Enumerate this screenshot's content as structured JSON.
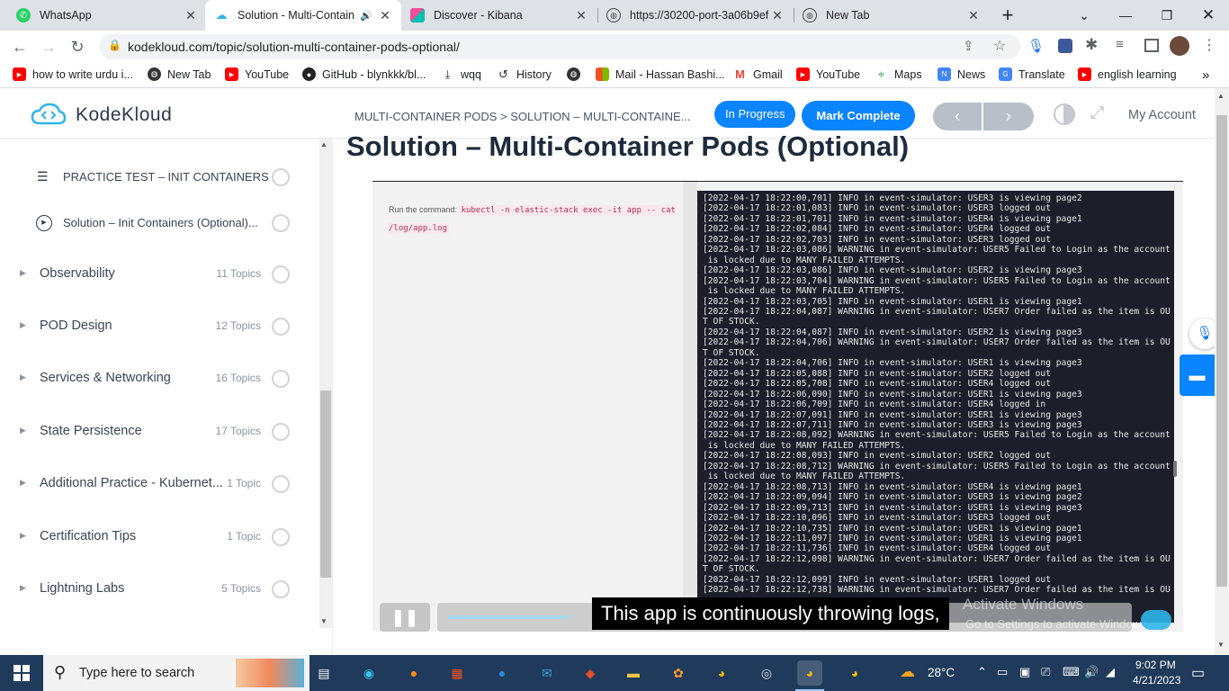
{
  "browser": {
    "tabs": [
      {
        "title": "WhatsApp",
        "icon": "whatsapp-icon"
      },
      {
        "title": "Solution - Multi-Contain",
        "icon": "kodekloud-icon",
        "active": true
      },
      {
        "title": "Discover - Kibana",
        "icon": "kibana-icon"
      },
      {
        "title": "https://30200-port-3a06b9ef",
        "icon": "globe-icon"
      },
      {
        "title": "New Tab",
        "icon": "globe-icon"
      }
    ],
    "url": "kodekloud.com/topic/solution-multi-container-pods-optional/",
    "bookmarks": [
      {
        "label": "how to write urdu i...",
        "icon": "youtube-icon"
      },
      {
        "label": "New Tab",
        "icon": "globe-icon"
      },
      {
        "label": "YouTube",
        "icon": "youtube-icon"
      },
      {
        "label": "GitHub - blynkkk/bl...",
        "icon": "github-icon"
      },
      {
        "label": "wqq",
        "icon": "download-icon"
      },
      {
        "label": "History",
        "icon": "history-icon"
      },
      {
        "label": "",
        "icon": "globe-icon"
      },
      {
        "label": "Mail - Hassan Bashi...",
        "icon": "microsoft-icon"
      },
      {
        "label": "Gmail",
        "icon": "gmail-icon"
      },
      {
        "label": "YouTube",
        "icon": "youtube-icon"
      },
      {
        "label": "Maps",
        "icon": "maps-icon"
      },
      {
        "label": "News",
        "icon": "news-icon"
      },
      {
        "label": "Translate",
        "icon": "translate-icon"
      },
      {
        "label": "english learning",
        "icon": "youtube-icon"
      }
    ]
  },
  "kk": {
    "brand": "KodeKloud",
    "breadcrumb": "MULTI-CONTAINER PODS > SOLUTION – MULTI-CONTAINE...",
    "status_label": "In Progress",
    "complete_label": "Mark Complete",
    "account_label": "My Account",
    "title": "Solution – Multi-Container Pods (Optional)",
    "sidebar": {
      "lessons": [
        {
          "label": "PRACTICE TEST – INIT CONTAINERS",
          "icon": "list-icon"
        },
        {
          "label": "Solution – Init Containers (Optional)...",
          "icon": "play-icon"
        }
      ],
      "sections": [
        {
          "label": "Observability",
          "count": "11 Topics"
        },
        {
          "label": "POD Design",
          "count": "12 Topics"
        },
        {
          "label": "Services & Networking",
          "count": "16 Topics"
        },
        {
          "label": "State Persistence",
          "count": "17 Topics"
        },
        {
          "label": "Additional Practice - Kubernet...",
          "count": "1 Topic"
        },
        {
          "label": "Certification Tips",
          "count": "1 Topic"
        },
        {
          "label": "Lightning Labs",
          "count": "5 Topics"
        }
      ]
    },
    "video": {
      "instruction_prefix": "Run the command:",
      "command": "kubectl -n elastic-stack exec -it app -- cat /log/app.log",
      "caption": "This app is continuously throwing logs,",
      "watermark_line1": "Activate Windows",
      "watermark_line2": "Go to Settings to activate Windows.",
      "progress": 0.18,
      "terminal_lines": [
        "[2022-04-17 18:22:00,701] INFO in event-simulator: USER3 is viewing page2",
        "[2022-04-17 18:22:01,083] INFO in event-simulator: USER3 logged out",
        "[2022-04-17 18:22:01,701] INFO in event-simulator: USER4 is viewing page1",
        "[2022-04-17 18:22:02,084] INFO in event-simulator: USER4 logged out",
        "[2022-04-17 18:22:02,703] INFO in event-simulator: USER3 logged out",
        "[2022-04-17 18:22:03,086] WARNING in event-simulator: USER5 Failed to Login as the account",
        " is locked due to MANY FAILED ATTEMPTS.",
        "[2022-04-17 18:22:03,086] INFO in event-simulator: USER2 is viewing page3",
        "[2022-04-17 18:22:03,704] WARNING in event-simulator: USER5 Failed to Login as the account",
        " is locked due to MANY FAILED ATTEMPTS.",
        "[2022-04-17 18:22:03,705] INFO in event-simulator: USER1 is viewing page1",
        "[2022-04-17 18:22:04,087] WARNING in event-simulator: USER7 Order failed as the item is OU",
        "T OF STOCK.",
        "[2022-04-17 18:22:04,087] INFO in event-simulator: USER2 is viewing page3",
        "[2022-04-17 18:22:04,706] WARNING in event-simulator: USER7 Order failed as the item is OU",
        "T OF STOCK.",
        "[2022-04-17 18:22:04,706] INFO in event-simulator: USER1 is viewing page3",
        "[2022-04-17 18:22:05,088] INFO in event-simulator: USER2 logged out",
        "[2022-04-17 18:22:05,708] INFO in event-simulator: USER4 logged out",
        "[2022-04-17 18:22:06,090] INFO in event-simulator: USER1 is viewing page3",
        "[2022-04-17 18:22:06,709] INFO in event-simulator: USER4 logged in",
        "[2022-04-17 18:22:07,091] INFO in event-simulator: USER1 is viewing page3",
        "[2022-04-17 18:22:07,711] INFO in event-simulator: USER3 is viewing page3",
        "[2022-04-17 18:22:08,092] WARNING in event-simulator: USER5 Failed to Login as the account",
        " is locked due to MANY FAILED ATTEMPTS.",
        "[2022-04-17 18:22:08,093] INFO in event-simulator: USER2 logged out",
        "[2022-04-17 18:22:08,712] WARNING in event-simulator: USER5 Failed to Login as the account",
        " is locked due to MANY FAILED ATTEMPTS.",
        "[2022-04-17 18:22:08,713] INFO in event-simulator: USER4 is viewing page1",
        "[2022-04-17 18:22:09,094] INFO in event-simulator: USER3 is viewing page2",
        "[2022-04-17 18:22:09,713] INFO in event-simulator: USER1 is viewing page3",
        "[2022-04-17 18:22:10,096] INFO in event-simulator: USER3 logged out",
        "[2022-04-17 18:22:10,735] INFO in event-simulator: USER1 is viewing page1",
        "[2022-04-17 18:22:11,097] INFO in event-simulator: USER1 is viewing page1",
        "[2022-04-17 18:22:11,736] INFO in event-simulator: USER4 logged out",
        "[2022-04-17 18:22:12,098] WARNING in event-simulator: USER7 Order failed as the item is OU",
        "T OF STOCK.",
        "[2022-04-17 18:22:12,099] INFO in event-simulator: USER1 logged out",
        "[2022-04-17 18:22:12,738] WARNING in event-simulator: USER7 Order failed as the item is OU"
      ]
    }
  },
  "taskbar": {
    "search_placeholder": "Type here to search",
    "weather": "28°C",
    "time": "9:02 PM",
    "date": "4/21/2023"
  },
  "colors": {
    "accent": "#0a84ff",
    "dark_text": "#1e2b3c",
    "taskbar": "#1f3a5a"
  }
}
